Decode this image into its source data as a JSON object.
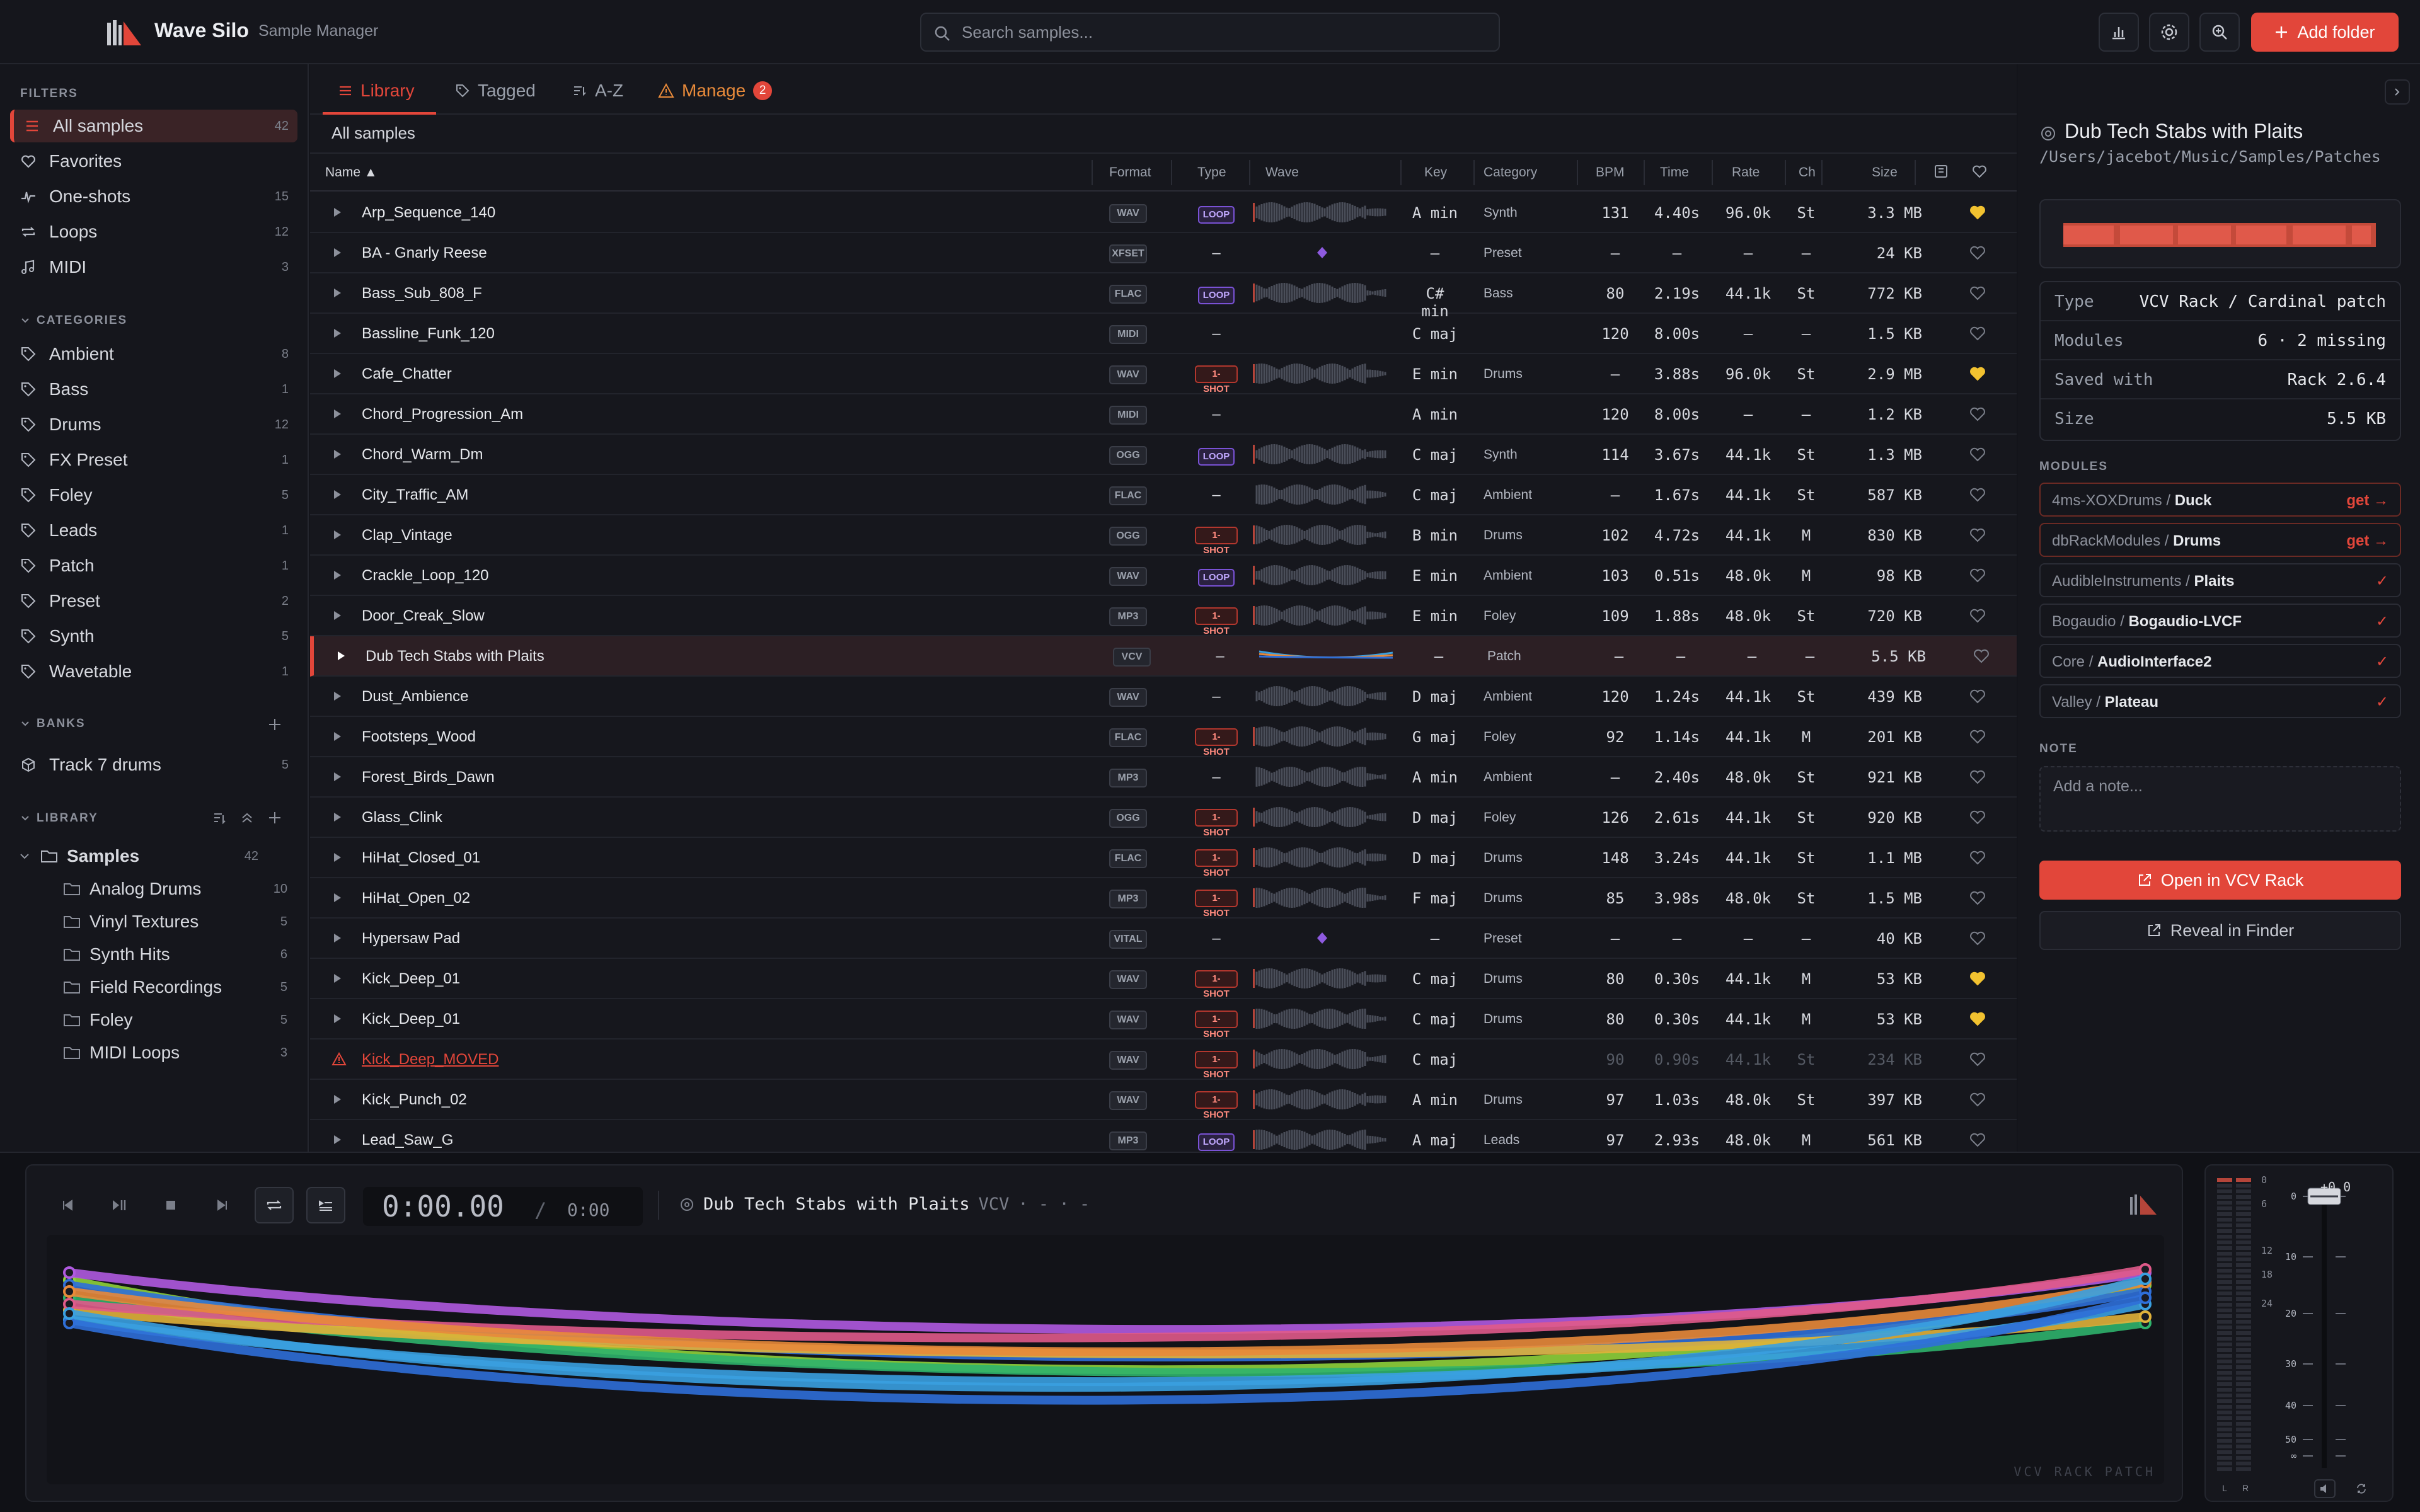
{
  "app": {
    "title": "Wave Silo",
    "subtitle": "Sample Manager"
  },
  "search": {
    "placeholder": "Search samples..."
  },
  "toolbar": {
    "add_folder_label": "Add folder"
  },
  "sidebar": {
    "filters_heading": "FILTERS",
    "filters": [
      {
        "label": "All samples",
        "count": "42",
        "icon": "list-icon"
      },
      {
        "label": "Favorites",
        "count": "",
        "icon": "heart-icon"
      },
      {
        "label": "One-shots",
        "count": "15",
        "icon": "one-shot-icon"
      },
      {
        "label": "Loops",
        "count": "12",
        "icon": "loop-icon"
      },
      {
        "label": "MIDI",
        "count": "3",
        "icon": "music-note-icon"
      }
    ],
    "categories_heading": "CATEGORIES",
    "categories": [
      {
        "label": "Ambient",
        "count": "8"
      },
      {
        "label": "Bass",
        "count": "1"
      },
      {
        "label": "Drums",
        "count": "12"
      },
      {
        "label": "FX Preset",
        "count": "1"
      },
      {
        "label": "Foley",
        "count": "5"
      },
      {
        "label": "Leads",
        "count": "1"
      },
      {
        "label": "Patch",
        "count": "1"
      },
      {
        "label": "Preset",
        "count": "2"
      },
      {
        "label": "Synth",
        "count": "5"
      },
      {
        "label": "Wavetable",
        "count": "1"
      }
    ],
    "banks_heading": "BANKS",
    "banks": [
      {
        "label": "Track 7 drums",
        "count": "5"
      }
    ],
    "library_heading": "LIBRARY",
    "library_root": {
      "label": "Samples",
      "count": "42"
    },
    "library_folders": [
      {
        "label": "Analog Drums",
        "count": "10"
      },
      {
        "label": "Vinyl Textures",
        "count": "5"
      },
      {
        "label": "Synth Hits",
        "count": "6"
      },
      {
        "label": "Field Recordings",
        "count": "5"
      },
      {
        "label": "Foley",
        "count": "5"
      },
      {
        "label": "MIDI Loops",
        "count": "3"
      }
    ]
  },
  "tabs": [
    {
      "label": "Library",
      "active": true
    },
    {
      "label": "Tagged",
      "active": false
    },
    {
      "label": "A-Z",
      "active": false
    },
    {
      "label": "Manage",
      "active": false,
      "badge": "2"
    }
  ],
  "breadcrumb": "All samples",
  "table": {
    "headers": {
      "name": "Name ▲",
      "format": "Format",
      "type": "Type",
      "wave": "Wave",
      "key": "Key",
      "category": "Category",
      "bpm": "BPM",
      "time": "Time",
      "rate": "Rate",
      "ch": "Ch",
      "size": "Size"
    },
    "rows": [
      {
        "name": "Arp_Sequence_140",
        "format": "WAV",
        "type": "LOOP",
        "key": "A min",
        "category": "Synth",
        "bpm": "131",
        "time": "4.40s",
        "rate": "96.0k",
        "ch": "St",
        "size": "3.3 MB",
        "fav": true
      },
      {
        "name": "BA - Gnarly Reese",
        "format": "XFSET",
        "type": "–",
        "key": "–",
        "category": "Preset",
        "bpm": "–",
        "time": "–",
        "rate": "–",
        "ch": "–",
        "size": "24 KB",
        "fav": false
      },
      {
        "name": "Bass_Sub_808_F",
        "format": "FLAC",
        "type": "LOOP",
        "key": "C# min",
        "category": "Bass",
        "bpm": "80",
        "time": "2.19s",
        "rate": "44.1k",
        "ch": "St",
        "size": "772 KB",
        "fav": false
      },
      {
        "name": "Bassline_Funk_120",
        "format": "MIDI",
        "type": "–",
        "key": "C maj",
        "category": "",
        "bpm": "120",
        "time": "8.00s",
        "rate": "–",
        "ch": "–",
        "size": "1.5 KB",
        "fav": false
      },
      {
        "name": "Cafe_Chatter",
        "format": "WAV",
        "type": "1-SHOT",
        "key": "E min",
        "category": "Drums",
        "bpm": "–",
        "time": "3.88s",
        "rate": "96.0k",
        "ch": "St",
        "size": "2.9 MB",
        "fav": true
      },
      {
        "name": "Chord_Progression_Am",
        "format": "MIDI",
        "type": "–",
        "key": "A min",
        "category": "",
        "bpm": "120",
        "time": "8.00s",
        "rate": "–",
        "ch": "–",
        "size": "1.2 KB",
        "fav": false
      },
      {
        "name": "Chord_Warm_Dm",
        "format": "OGG",
        "type": "LOOP",
        "key": "C maj",
        "category": "Synth",
        "bpm": "114",
        "time": "3.67s",
        "rate": "44.1k",
        "ch": "St",
        "size": "1.3 MB",
        "fav": false
      },
      {
        "name": "City_Traffic_AM",
        "format": "FLAC",
        "type": "–",
        "key": "C maj",
        "category": "Ambient",
        "bpm": "–",
        "time": "1.67s",
        "rate": "44.1k",
        "ch": "St",
        "size": "587 KB",
        "fav": false
      },
      {
        "name": "Clap_Vintage",
        "format": "OGG",
        "type": "1-SHOT",
        "key": "B min",
        "category": "Drums",
        "bpm": "102",
        "time": "4.72s",
        "rate": "44.1k",
        "ch": "M",
        "size": "830 KB",
        "fav": false
      },
      {
        "name": "Crackle_Loop_120",
        "format": "WAV",
        "type": "LOOP",
        "key": "E min",
        "category": "Ambient",
        "bpm": "103",
        "time": "0.51s",
        "rate": "48.0k",
        "ch": "M",
        "size": "98 KB",
        "fav": false
      },
      {
        "name": "Door_Creak_Slow",
        "format": "MP3",
        "type": "1-SHOT",
        "key": "E min",
        "category": "Foley",
        "bpm": "109",
        "time": "1.88s",
        "rate": "48.0k",
        "ch": "St",
        "size": "720 KB",
        "fav": false
      },
      {
        "name": "Dub Tech Stabs with Plaits",
        "format": "VCV",
        "type": "–",
        "key": "–",
        "category": "Patch",
        "bpm": "–",
        "time": "–",
        "rate": "–",
        "ch": "–",
        "size": "5.5 KB",
        "fav": false
      },
      {
        "name": "Dust_Ambience",
        "format": "WAV",
        "type": "–",
        "key": "D maj",
        "category": "Ambient",
        "bpm": "120",
        "time": "1.24s",
        "rate": "44.1k",
        "ch": "St",
        "size": "439 KB",
        "fav": false
      },
      {
        "name": "Footsteps_Wood",
        "format": "FLAC",
        "type": "1-SHOT",
        "key": "G maj",
        "category": "Foley",
        "bpm": "92",
        "time": "1.14s",
        "rate": "44.1k",
        "ch": "M",
        "size": "201 KB",
        "fav": false
      },
      {
        "name": "Forest_Birds_Dawn",
        "format": "MP3",
        "type": "–",
        "key": "A min",
        "category": "Ambient",
        "bpm": "–",
        "time": "2.40s",
        "rate": "48.0k",
        "ch": "St",
        "size": "921 KB",
        "fav": false
      },
      {
        "name": "Glass_Clink",
        "format": "OGG",
        "type": "1-SHOT",
        "key": "D maj",
        "category": "Foley",
        "bpm": "126",
        "time": "2.61s",
        "rate": "44.1k",
        "ch": "St",
        "size": "920 KB",
        "fav": false
      },
      {
        "name": "HiHat_Closed_01",
        "format": "FLAC",
        "type": "1-SHOT",
        "key": "D maj",
        "category": "Drums",
        "bpm": "148",
        "time": "3.24s",
        "rate": "44.1k",
        "ch": "St",
        "size": "1.1 MB",
        "fav": false
      },
      {
        "name": "HiHat_Open_02",
        "format": "MP3",
        "type": "1-SHOT",
        "key": "F maj",
        "category": "Drums",
        "bpm": "85",
        "time": "3.98s",
        "rate": "48.0k",
        "ch": "St",
        "size": "1.5 MB",
        "fav": false
      },
      {
        "name": "Hypersaw Pad",
        "format": "VITAL",
        "type": "–",
        "key": "–",
        "category": "Preset",
        "bpm": "–",
        "time": "–",
        "rate": "–",
        "ch": "–",
        "size": "40 KB",
        "fav": false
      },
      {
        "name": "Kick_Deep_01",
        "format": "WAV",
        "type": "1-SHOT",
        "key": "C maj",
        "category": "Drums",
        "bpm": "80",
        "time": "0.30s",
        "rate": "44.1k",
        "ch": "M",
        "size": "53 KB",
        "fav": true
      },
      {
        "name": "Kick_Deep_01",
        "format": "WAV",
        "type": "1-SHOT",
        "key": "C maj",
        "category": "Drums",
        "bpm": "80",
        "time": "0.30s",
        "rate": "44.1k",
        "ch": "M",
        "size": "53 KB",
        "fav": true
      },
      {
        "name": "Kick_Deep_MOVED",
        "format": "WAV",
        "type": "1-SHOT",
        "key": "C maj",
        "category": "",
        "bpm": "90",
        "time": "0.90s",
        "rate": "44.1k",
        "ch": "St",
        "size": "234 KB",
        "fav": false
      },
      {
        "name": "Kick_Punch_02",
        "format": "WAV",
        "type": "1-SHOT",
        "key": "A min",
        "category": "Drums",
        "bpm": "97",
        "time": "1.03s",
        "rate": "48.0k",
        "ch": "St",
        "size": "397 KB",
        "fav": false
      },
      {
        "name": "Lead_Saw_G",
        "format": "MP3",
        "type": "LOOP",
        "key": "A maj",
        "category": "Leads",
        "bpm": "97",
        "time": "2.93s",
        "rate": "48.0k",
        "ch": "M",
        "size": "561 KB",
        "fav": false
      }
    ]
  },
  "details": {
    "title": "Dub Tech Stabs with Plaits",
    "path": "/Users/jacebot/Music/Samples/Patches",
    "props": [
      {
        "k": "Type",
        "v": "VCV Rack / Cardinal patch"
      },
      {
        "k": "Modules",
        "v": "6 · 2 missing"
      },
      {
        "k": "Saved with",
        "v": "Rack 2.6.4"
      },
      {
        "k": "Size",
        "v": "5.5 KB"
      }
    ],
    "modules_heading": "MODULES",
    "modules": [
      {
        "plugin": "4ms-XOXDrums",
        "name": "Duck",
        "status": "get →"
      },
      {
        "plugin": "dbRackModules",
        "name": "Drums",
        "status": "get →"
      },
      {
        "plugin": "AudibleInstruments",
        "name": "Plaits",
        "status": "✓"
      },
      {
        "plugin": "Bogaudio",
        "name": "Bogaudio-LVCF",
        "status": "✓"
      },
      {
        "plugin": "Core",
        "name": "AudioInterface2",
        "status": "✓"
      },
      {
        "plugin": "Valley",
        "name": "Plateau",
        "status": "✓"
      }
    ],
    "note_heading": "NOTE",
    "note_placeholder": "Add a note...",
    "open_label": "Open in VCV Rack",
    "reveal_label": "Reveal in Finder"
  },
  "player": {
    "current_time": "0:00.00",
    "separator": "/",
    "total_time": "0:00",
    "now_playing": "Dub Tech Stabs with Plaits",
    "now_format": "VCV",
    "now_dots": "· - · -",
    "wave_label": "VCV RACK PATCH",
    "cable_colors": [
      "#8fd13a",
      "#b05ae0",
      "#2f6fd8",
      "#2fb36b",
      "#e0b13a",
      "#e05a8a",
      "#e88a3a",
      "#3aa0e0",
      "#c8c8d8"
    ]
  },
  "meters": {
    "gain": "+0.0",
    "scale": [
      "0",
      "6",
      "12",
      "18",
      "24",
      "0",
      "10",
      "20",
      "30",
      "40",
      "50",
      "∞"
    ],
    "l_label": "L",
    "r_label": "R"
  }
}
